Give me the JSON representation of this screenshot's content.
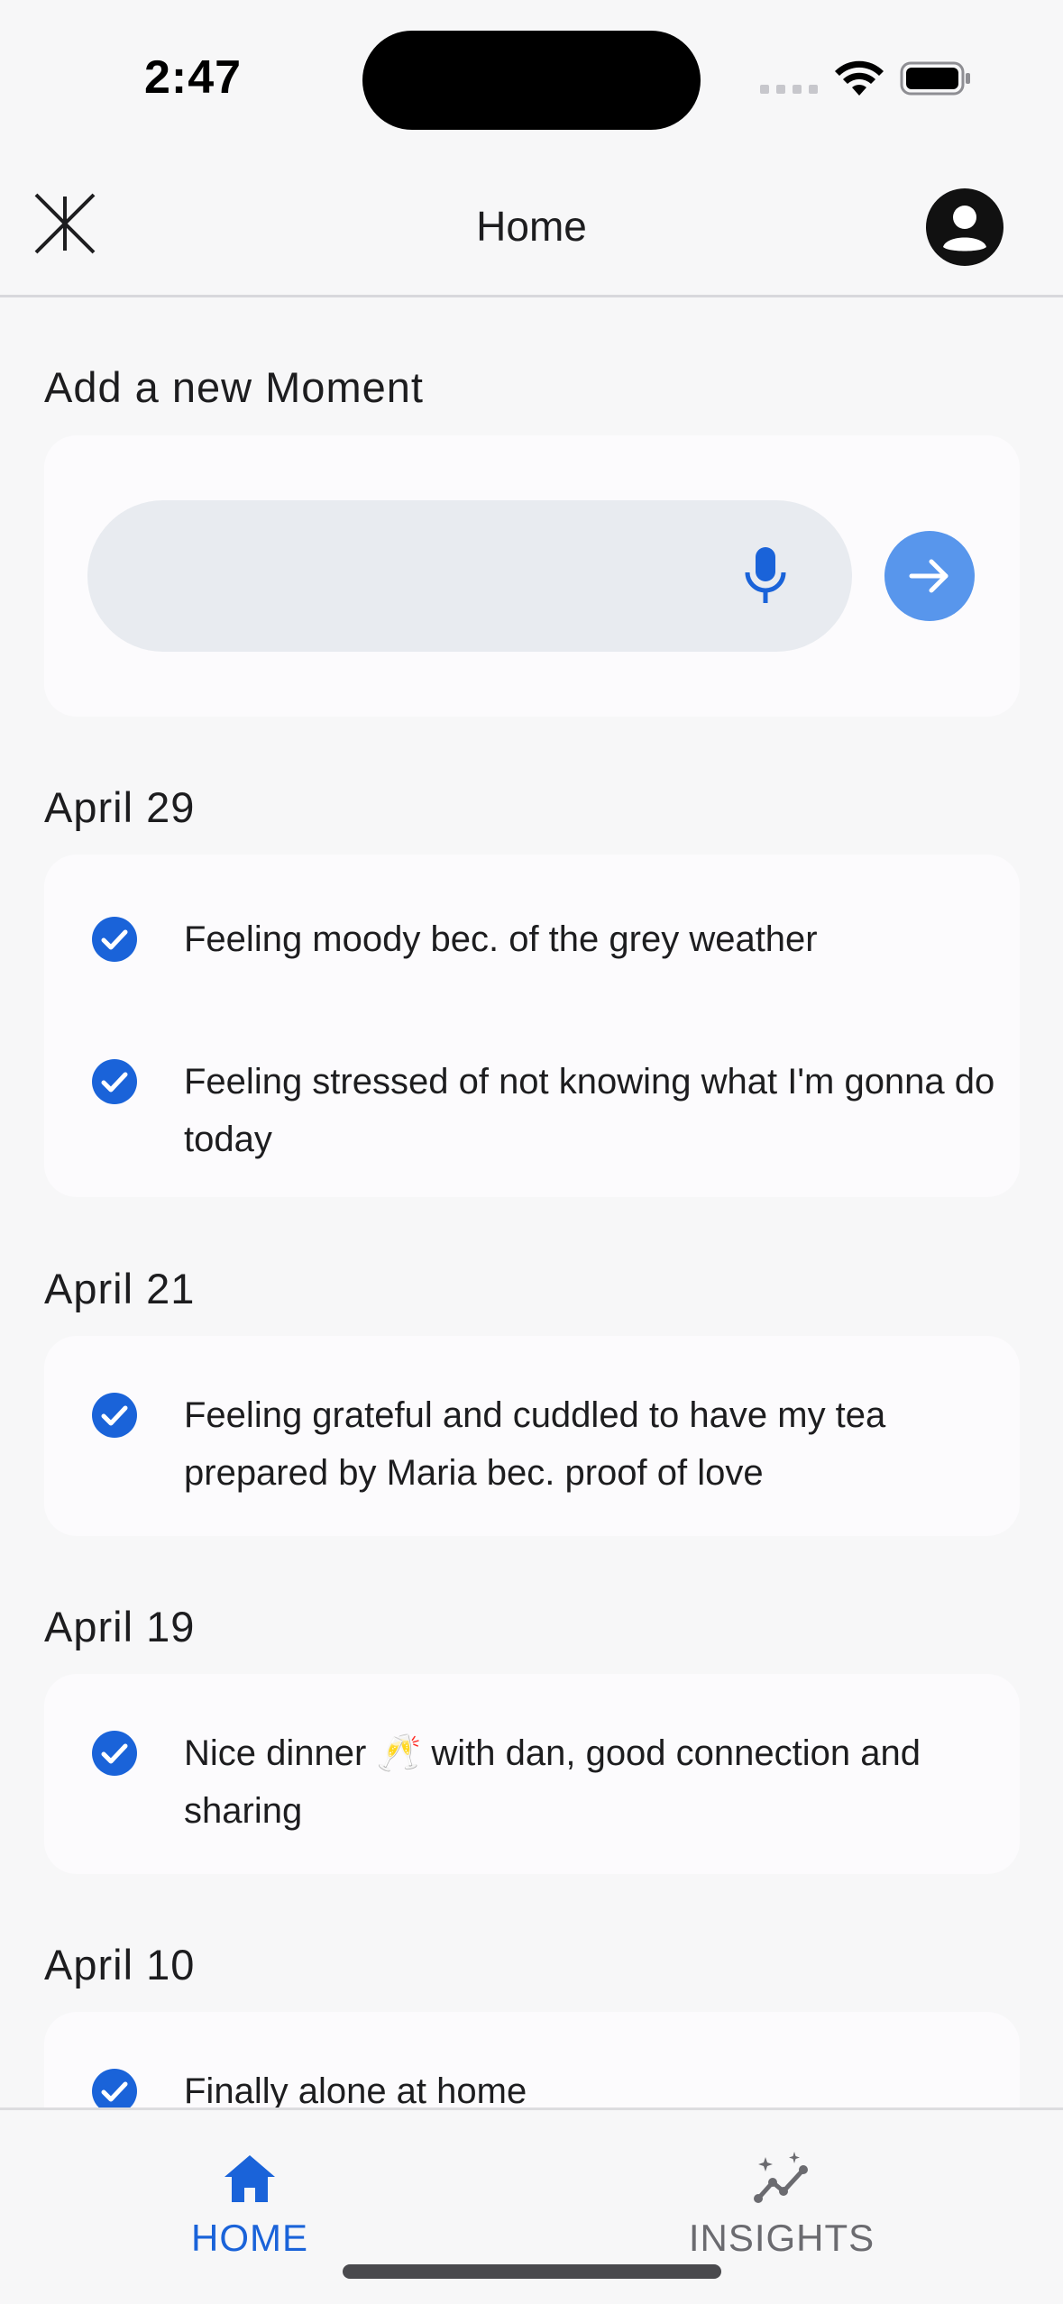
{
  "status_bar": {
    "time": "2:47"
  },
  "header": {
    "title": "Home"
  },
  "composer": {
    "section_title": "Add a new Moment",
    "input_value": ""
  },
  "groups": [
    {
      "date": "April 29",
      "entries": [
        "Feeling moody bec. of the grey weather",
        "Feeling stressed of not knowing what I'm gonna do today"
      ]
    },
    {
      "date": "April 21",
      "entries": [
        "Feeling grateful and cuddled to have my tea prepared by Maria bec. proof of love"
      ]
    },
    {
      "date": "April 19",
      "entries": [
        "Nice dinner 🥂 with dan, good connection and sharing"
      ]
    },
    {
      "date": "April 10",
      "entries": [
        "Finally alone at home"
      ]
    }
  ],
  "bottom_nav": {
    "home_label": "HOME",
    "insights_label": "INSIGHTS",
    "active": "home"
  },
  "colors": {
    "accent": "#1a63d9",
    "send_button": "#5896ec",
    "inactive_nav": "#6b6b70",
    "card_bg": "#fcfbfd",
    "page_bg": "#f7f7f8"
  }
}
